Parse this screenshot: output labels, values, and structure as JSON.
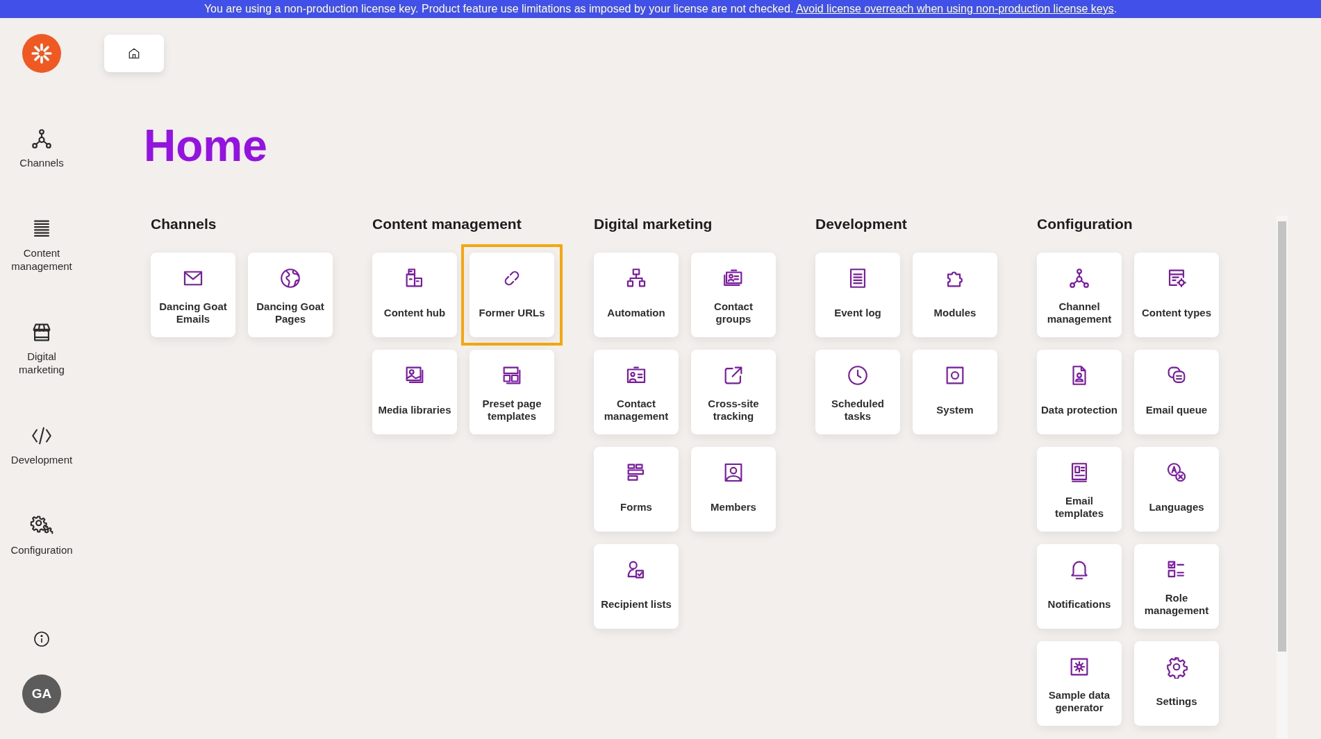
{
  "banner": {
    "text": "You are using a non-production license key. Product feature use limitations as imposed by your license are not checked.",
    "link": "Avoid license overreach when using non-production license keys",
    "after_link": "."
  },
  "sidebar": {
    "items": [
      {
        "label": "Channels",
        "kind": "network"
      },
      {
        "label": "Content management",
        "kind": "list"
      },
      {
        "label": "Digital marketing",
        "kind": "storefront"
      },
      {
        "label": "Development",
        "kind": "code"
      },
      {
        "label": "Configuration",
        "kind": "gears"
      }
    ],
    "avatar": "GA"
  },
  "title": "Home",
  "sections": [
    {
      "heading": "Channels",
      "tiles": [
        {
          "label": "Dancing Goat Emails",
          "kind": "envelope",
          "selected": false
        },
        {
          "label": "Dancing Goat Pages",
          "kind": "globe",
          "selected": false
        }
      ]
    },
    {
      "heading": "Content management",
      "tiles": [
        {
          "label": "Content hub",
          "kind": "boxes",
          "selected": false
        },
        {
          "label": "Former URLs",
          "kind": "link",
          "selected": true
        },
        {
          "label": "Media libraries",
          "kind": "image",
          "selected": false
        },
        {
          "label": "Preset page templates",
          "kind": "layout",
          "selected": false
        }
      ]
    },
    {
      "heading": "Digital marketing",
      "tiles": [
        {
          "label": "Automation",
          "kind": "hierarchy",
          "selected": false
        },
        {
          "label": "Contact groups",
          "kind": "cards",
          "selected": false
        },
        {
          "label": "Contact management",
          "kind": "card",
          "selected": false
        },
        {
          "label": "Cross-site tracking",
          "kind": "external",
          "selected": false
        },
        {
          "label": "Forms",
          "kind": "form",
          "selected": false
        },
        {
          "label": "Members",
          "kind": "portrait",
          "selected": false
        },
        {
          "label": "Recipient lists",
          "kind": "personcheck",
          "selected": false
        }
      ]
    },
    {
      "heading": "Development",
      "tiles": [
        {
          "label": "Event log",
          "kind": "document",
          "selected": false
        },
        {
          "label": "Modules",
          "kind": "puzzle",
          "selected": false
        },
        {
          "label": "Scheduled tasks",
          "kind": "clock",
          "selected": false
        },
        {
          "label": "System",
          "kind": "squarecircle",
          "selected": false
        }
      ]
    },
    {
      "heading": "Configuration",
      "tiles": [
        {
          "label": "Channel management",
          "kind": "network",
          "selected": false
        },
        {
          "label": "Content types",
          "kind": "windowgear",
          "selected": false
        },
        {
          "label": "Data protection",
          "kind": "fileperson",
          "selected": false
        },
        {
          "label": "Email queue",
          "kind": "bubbles",
          "selected": false
        },
        {
          "label": "Email templates",
          "kind": "newsletter",
          "selected": false
        },
        {
          "label": "Languages",
          "kind": "translate",
          "selected": false
        },
        {
          "label": "Notifications",
          "kind": "bell",
          "selected": false
        },
        {
          "label": "Role management",
          "kind": "checklist",
          "selected": false
        },
        {
          "label": "Sample data generator",
          "kind": "gearsquare",
          "selected": false
        },
        {
          "label": "Settings",
          "kind": "gear",
          "selected": false
        }
      ]
    }
  ]
}
